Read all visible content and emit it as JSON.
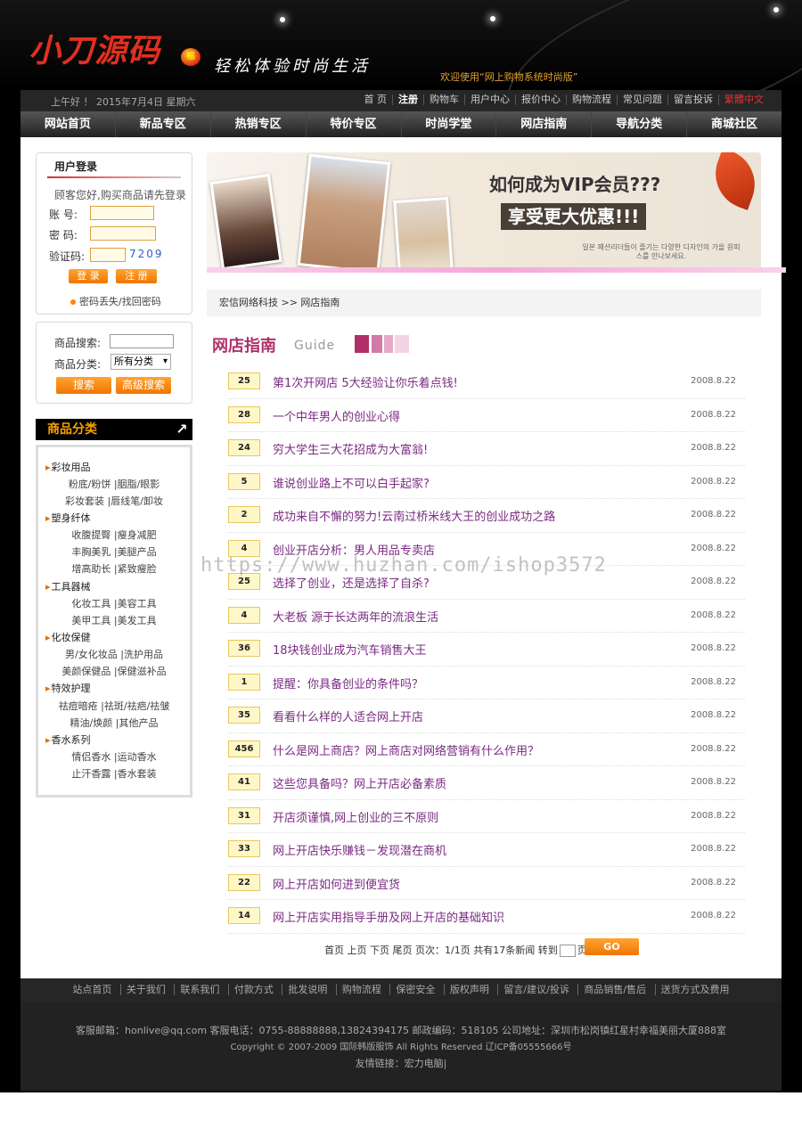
{
  "header": {
    "logo_text": "小刀源码",
    "slogan": "轻松体验时尚生活",
    "welcome": "欢迎使用“网上购物系统时尚版”"
  },
  "topbar": {
    "greeting": "上午好 ！  2015年7月4日 星期六",
    "links": [
      "首 页",
      "注册",
      "购物车",
      "用户中心",
      "报价中心",
      "购物流程",
      "常见问题",
      "留言投诉",
      "繁體中文"
    ]
  },
  "nav": [
    "网站首页",
    "新品专区",
    "热销专区",
    "特价专区",
    "时尚学堂",
    "网店指南",
    "导航分类",
    "商城社区"
  ],
  "login": {
    "title": "用户登录",
    "hint": "顾客您好,购买商品请先登录",
    "account_label": "账  号:",
    "password_label": "密  码:",
    "captcha_label": "验证码:",
    "captcha_value": "7209",
    "login_button": "登 录",
    "register_button": "注 册",
    "forgot": "密码丢失/找回密码"
  },
  "search": {
    "keyword_label": "商品搜索:",
    "category_label": "商品分类:",
    "category_value": "所有分类",
    "search_button": "搜索",
    "advanced_button": "高级搜索"
  },
  "categories": {
    "title": "商品分类",
    "groups": [
      {
        "name": "彩妆用品",
        "subs": [
          "粉底/粉饼 |胭脂/眼影",
          "彩妆套装 |唇线笔/卸妆"
        ]
      },
      {
        "name": "塑身纤体",
        "subs": [
          "收腹提臀 |瘦身减肥",
          "丰胸美乳 |美腿产品",
          "增高助长 |紧致瘦脸"
        ]
      },
      {
        "name": "工具器械",
        "subs": [
          "化妆工具 |美容工具",
          "美甲工具 |美发工具"
        ]
      },
      {
        "name": "化妆保健",
        "subs": [
          "男/女化妆品 |洗护用品",
          "美颜保健品 |保健滋补品"
        ]
      },
      {
        "name": "特效护理",
        "subs": [
          "祛痘暗疮 |祛斑/祛疤/祛皱",
          "精油/焕颜 |其他产品"
        ]
      },
      {
        "name": "香水系列",
        "subs": [
          "情侣香水 |运动香水",
          "止汗香露 |香水套装"
        ]
      }
    ]
  },
  "banner": {
    "line1": "如何成为VIP会员???",
    "line2": "享受更大优惠!!!",
    "small_text": "일본 패션리더들이 즐기는 다양한 디자인의 가을 원피스를 만나보세요."
  },
  "breadcrumb": "宏信网络科技 >> 网店指南",
  "section": {
    "title": "网店指南",
    "subtitle": "Guide"
  },
  "articles": [
    {
      "count": "25",
      "title": "第1次开网店 5大经验让你乐着点钱!",
      "date": "2008.8.22"
    },
    {
      "count": "28",
      "title": "一个中年男人的创业心得",
      "date": "2008.8.22"
    },
    {
      "count": "24",
      "title": "穷大学生三大花招成为大富翁!",
      "date": "2008.8.22"
    },
    {
      "count": "5",
      "title": "谁说创业路上不可以白手起家?",
      "date": "2008.8.22"
    },
    {
      "count": "2",
      "title": "成功来自不懈的努力!云南过桥米线大王的创业成功之路",
      "date": "2008.8.22"
    },
    {
      "count": "4",
      "title": "创业开店分析：男人用品专卖店",
      "date": "2008.8.22"
    },
    {
      "count": "25",
      "title": "选择了创业，还是选择了自杀?",
      "date": "2008.8.22"
    },
    {
      "count": "4",
      "title": "大老板 源于长达两年的流浪生活",
      "date": "2008.8.22"
    },
    {
      "count": "36",
      "title": "18块钱创业成为汽车销售大王",
      "date": "2008.8.22"
    },
    {
      "count": "1",
      "title": "提醒：你具备创业的条件吗？",
      "date": "2008.8.22"
    },
    {
      "count": "35",
      "title": "看看什么样的人适合网上开店",
      "date": "2008.8.22"
    },
    {
      "count": "456",
      "title": "什么是网上商店？网上商店对网络营销有什么作用？",
      "date": "2008.8.22"
    },
    {
      "count": "41",
      "title": "这些您具备吗？网上开店必备素质",
      "date": "2008.8.22"
    },
    {
      "count": "31",
      "title": "开店须谨慎,网上创业的三不原则",
      "date": "2008.8.22"
    },
    {
      "count": "33",
      "title": "网上开店快乐赚钱－发现潜在商机",
      "date": "2008.8.22"
    },
    {
      "count": "22",
      "title": "网上开店如何进到便宜货",
      "date": "2008.8.22"
    },
    {
      "count": "14",
      "title": "网上开店实用指导手册及网上开店的基础知识",
      "date": "2008.8.22"
    }
  ],
  "pager": {
    "first": "首页",
    "prev": "上页",
    "next": "下页",
    "last": "尾页",
    "info": "页次：1/1页 共有17条新闻 转到",
    "unit": "页",
    "go": "GO"
  },
  "footer": {
    "links": [
      "站点首页",
      "关于我们",
      "联系我们",
      "付款方式",
      "批发说明",
      "购物流程",
      "保密安全",
      "版权声明",
      "留言/建议/投诉",
      "商品销售/售后",
      "送货方式及费用"
    ],
    "contact": "客服邮箱：honlive@qq.com   客服电话：0755-88888888,13824394175 邮政编码：518105 公司地址：深圳市松岗镇红星村幸福美丽大厦888室",
    "copyright": "Copyright © 2007-2009 国际韩版服饰 All Rights Reserved 辽ICP备05555666号",
    "friends": "友情链接：宏力电脑|"
  },
  "watermark": "https://www.huzhan.com/ishop3572",
  "colors": {
    "accent": "#f07500",
    "title_purple": "#7a2a82",
    "section_pink": "#b0306a"
  }
}
